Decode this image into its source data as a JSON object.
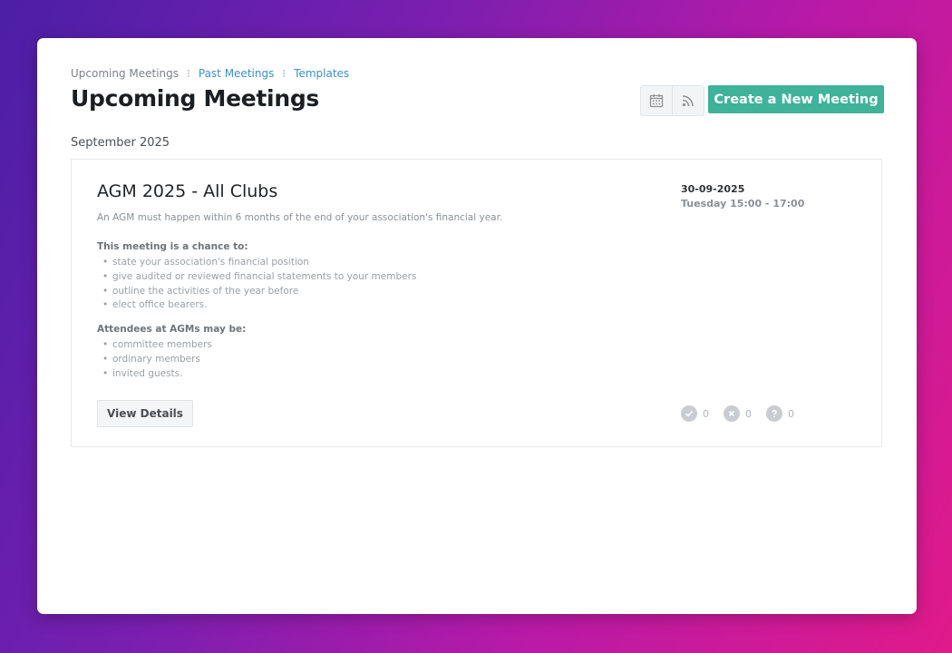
{
  "breadcrumb": {
    "items": [
      {
        "label": "Upcoming Meetings",
        "active": true
      },
      {
        "label": "Past Meetings",
        "active": false
      },
      {
        "label": "Templates",
        "active": false
      }
    ]
  },
  "header": {
    "title": "Upcoming Meetings",
    "calendar_icon": "calendar-icon",
    "rss_icon": "rss-icon",
    "create_label": "Create a New Meeting"
  },
  "month_label": "September 2025",
  "meeting": {
    "title": "AGM 2025 - All Clubs",
    "description": "An AGM must happen within 6 months of the end of your association's financial year.",
    "chance_heading": "This meeting is a chance to:",
    "chance_items": [
      "state your association's financial position",
      "give audited or reviewed financial statements to your members",
      "outline the activities of the year before",
      "elect office bearers."
    ],
    "attendees_heading": "Attendees at AGMs may be:",
    "attendees_items": [
      "committee members",
      "ordinary members",
      "invited guests."
    ],
    "view_details_label": "View Details",
    "date": "30-09-2025",
    "time": "Tuesday 15:00 - 17:00",
    "rsvp": {
      "accepted": "0",
      "declined": "0",
      "unknown": "0"
    }
  },
  "colors": {
    "accent": "#3fb39a",
    "link": "#3f8fc5"
  }
}
